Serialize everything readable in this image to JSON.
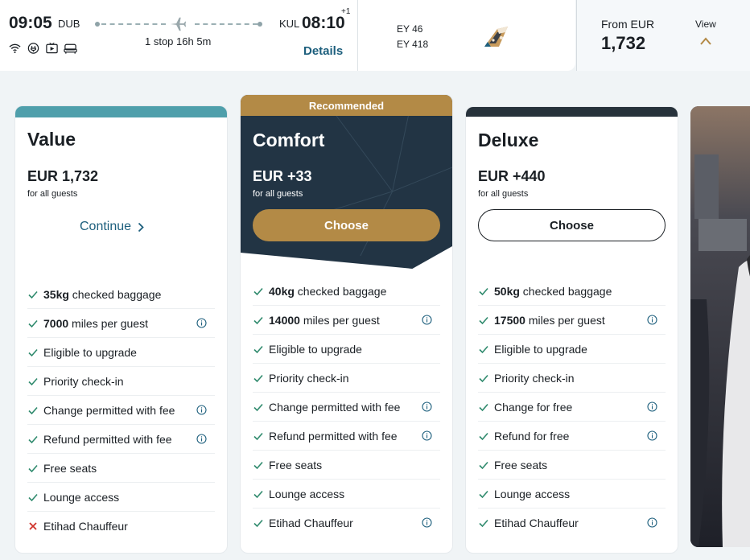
{
  "flight": {
    "departure_time": "09:05",
    "departure_code": "DUB",
    "arrival_code": "KUL",
    "arrival_time": "08:10",
    "day_offset": "+1",
    "stops": "1 stop 16h 5m",
    "details_label": "Details",
    "amenities": [
      "wifi-icon",
      "power-icon",
      "entertainment-icon",
      "seat-icon"
    ],
    "flight_numbers": [
      "EY 46",
      "EY 418"
    ],
    "airline_logo": "etihad-tail-logo",
    "from_label": "From EUR",
    "from_price": "1,732",
    "view_label": "View"
  },
  "colors": {
    "value_strip": "#4f9fab",
    "comfort_gold": "#b38a46",
    "comfort_bg": "#223444",
    "deluxe_strip": "#27323b",
    "link": "#1d5f7d",
    "check": "#2f8a6d",
    "cross": "#d0342c"
  },
  "fares": [
    {
      "name": "Value",
      "price": "EUR 1,732",
      "sub": "for all guests",
      "action": "Continue",
      "features": [
        {
          "bold": "35kg",
          "text": " checked baggage",
          "status": "check",
          "info": false
        },
        {
          "bold": "7000",
          "text": " miles per guest",
          "status": "check",
          "info": true
        },
        {
          "bold": "",
          "text": "Eligible to upgrade",
          "status": "check",
          "info": false
        },
        {
          "bold": "",
          "text": "Priority check-in",
          "status": "check",
          "info": false
        },
        {
          "bold": "",
          "text": "Change permitted with fee",
          "status": "check",
          "info": true
        },
        {
          "bold": "",
          "text": "Refund permitted with fee",
          "status": "check",
          "info": true
        },
        {
          "bold": "",
          "text": "Free seats",
          "status": "check",
          "info": false
        },
        {
          "bold": "",
          "text": "Lounge access",
          "status": "check",
          "info": false
        },
        {
          "bold": "",
          "text": "Etihad Chauffeur",
          "status": "cross",
          "info": false
        }
      ]
    },
    {
      "name": "Comfort",
      "badge": "Recommended",
      "price": "EUR +33",
      "sub": "for all guests",
      "action": "Choose",
      "features": [
        {
          "bold": "40kg",
          "text": " checked baggage",
          "status": "check",
          "info": false
        },
        {
          "bold": "14000",
          "text": " miles per guest",
          "status": "check",
          "info": true
        },
        {
          "bold": "",
          "text": "Eligible to upgrade",
          "status": "check",
          "info": false
        },
        {
          "bold": "",
          "text": "Priority check-in",
          "status": "check",
          "info": false
        },
        {
          "bold": "",
          "text": "Change permitted with fee",
          "status": "check",
          "info": true
        },
        {
          "bold": "",
          "text": "Refund permitted with fee",
          "status": "check",
          "info": true
        },
        {
          "bold": "",
          "text": "Free seats",
          "status": "check",
          "info": false
        },
        {
          "bold": "",
          "text": "Lounge access",
          "status": "check",
          "info": false
        },
        {
          "bold": "",
          "text": "Etihad Chauffeur",
          "status": "check",
          "info": true
        }
      ]
    },
    {
      "name": "Deluxe",
      "price": "EUR +440",
      "sub": "for all guests",
      "action": "Choose",
      "features": [
        {
          "bold": "50kg",
          "text": " checked baggage",
          "status": "check",
          "info": false
        },
        {
          "bold": "17500",
          "text": " miles per guest",
          "status": "check",
          "info": true
        },
        {
          "bold": "",
          "text": "Eligible to upgrade",
          "status": "check",
          "info": false
        },
        {
          "bold": "",
          "text": "Priority check-in",
          "status": "check",
          "info": false
        },
        {
          "bold": "",
          "text": "Change for free",
          "status": "check",
          "info": true
        },
        {
          "bold": "",
          "text": "Refund for free",
          "status": "check",
          "info": true
        },
        {
          "bold": "",
          "text": "Free seats",
          "status": "check",
          "info": false
        },
        {
          "bold": "",
          "text": "Lounge access",
          "status": "check",
          "info": false
        },
        {
          "bold": "",
          "text": "Etihad Chauffeur",
          "status": "check",
          "info": true
        }
      ]
    }
  ]
}
